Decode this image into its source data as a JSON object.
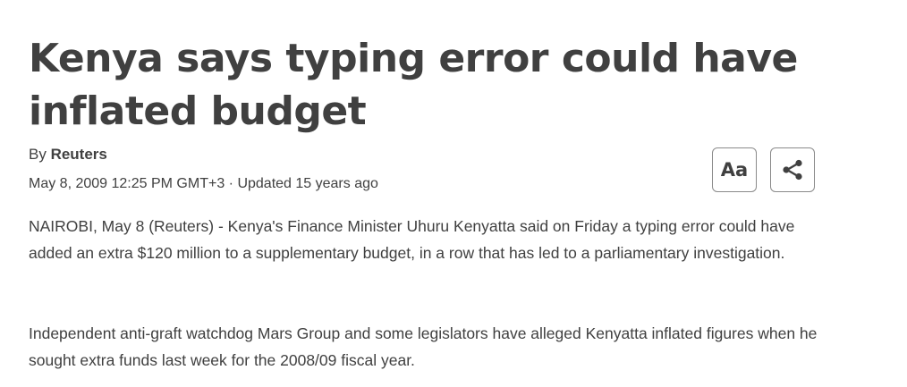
{
  "article": {
    "headline": "Kenya says typing error could have inflated budget",
    "byline_prefix": "By ",
    "author": "Reuters",
    "dateline": "May 8, 2009 12:25 PM GMT+3 · Updated 15 years ago",
    "paragraphs": [
      "NAIROBI, May 8 (Reuters) - Kenya's Finance Minister Uhuru Kenyatta said on Friday a typing error could have added an extra $120 million to a supplementary budget, in a row that has led to a parliamentary investigation.",
      "Independent anti-graft watchdog Mars Group and some legislators have alleged Kenyatta inflated figures when he sought extra funds last week for the 2008/09 fiscal year."
    ]
  },
  "toolbar": {
    "text_size_label": "Aa",
    "share_icon": "share-icon"
  }
}
